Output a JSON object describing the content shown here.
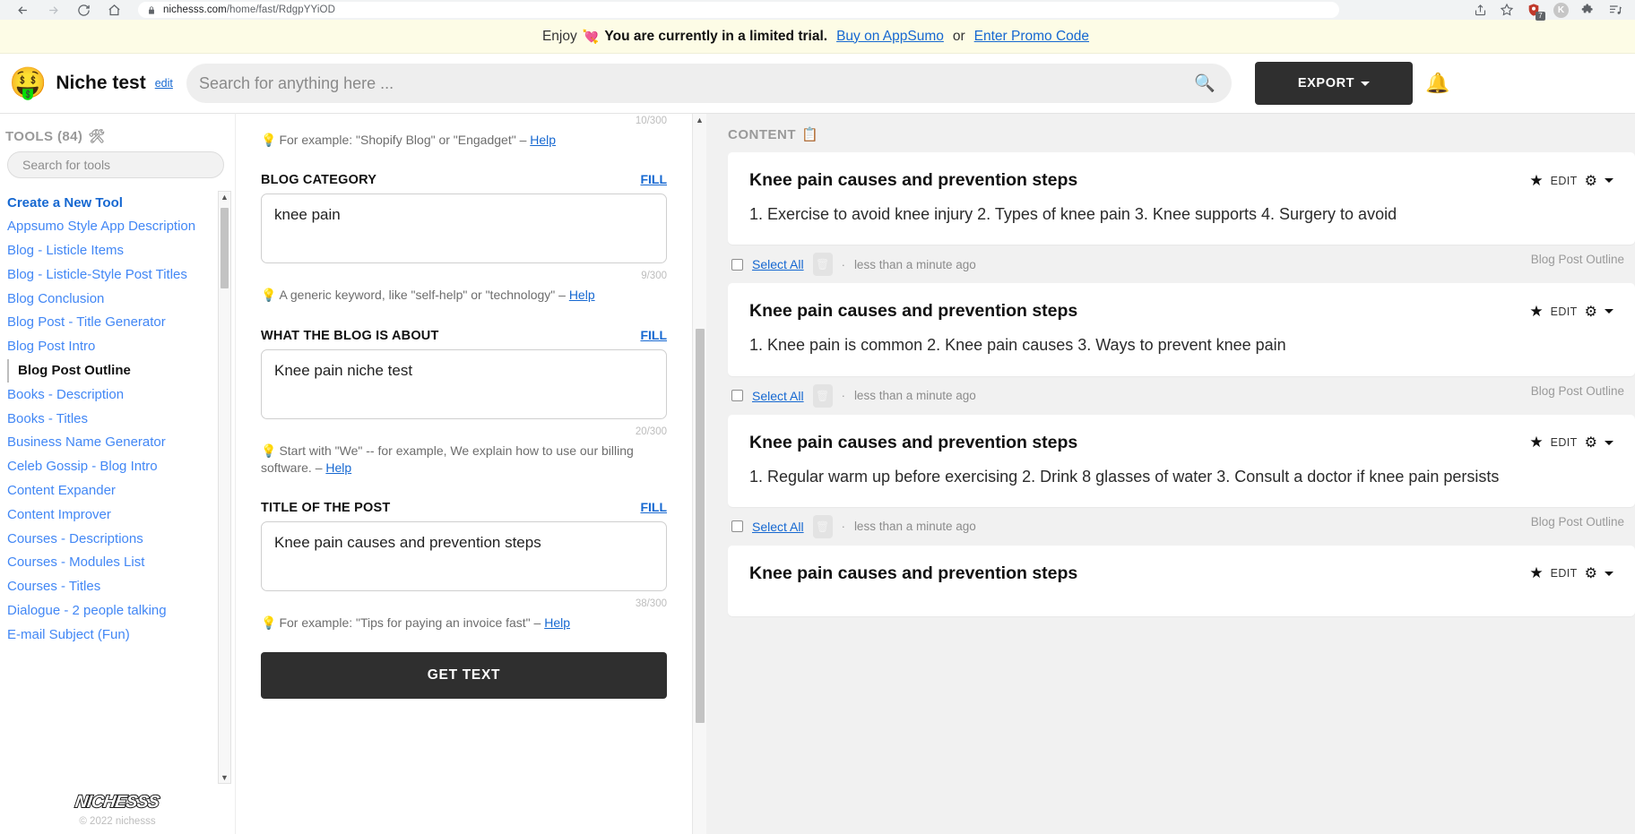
{
  "browser": {
    "url_prefix": "nichesss.com",
    "url_suffix": "/home/fast/RdgpYYiOD",
    "icons": {
      "back": "back-arrow-icon",
      "forward": "forward-arrow-icon",
      "reload": "reload-icon",
      "home": "home-icon",
      "lock": "lock-icon",
      "share": "share-icon",
      "bookmark": "star-bookmark-icon",
      "shield_extension": "shield-extension-icon",
      "profile": "profile-avatar-icon",
      "extensions": "puzzle-extensions-icon",
      "reading_list": "reading-list-icon"
    },
    "extension_badge_count": "7",
    "profile_initial": "K"
  },
  "banner": {
    "enjoy": "Enjoy",
    "heart": "💘",
    "message": "You are currently in a limited trial.",
    "buy_link": "Buy on AppSumo",
    "or": "or",
    "promo_link": "Enter Promo Code"
  },
  "header": {
    "logo_emoji": "🤑",
    "project_title": "Niche test",
    "edit_label": "edit",
    "search_placeholder": "Search for anything here ...",
    "search_value": "",
    "search_icon": "🔍",
    "export_label": "EXPORT"
  },
  "sidebar": {
    "heading": "TOOLS (84)",
    "heading_emoji": "🛠",
    "search_placeholder": "Search for tools",
    "search_value": "",
    "items": [
      {
        "label": "Create a New Tool",
        "style": "first"
      },
      {
        "label": "Appsumo Style App Description",
        "style": "link"
      },
      {
        "label": "Blog - Listicle Items",
        "style": "link"
      },
      {
        "label": "Blog - Listicle-Style Post Titles",
        "style": "link"
      },
      {
        "label": "Blog Conclusion",
        "style": "link"
      },
      {
        "label": "Blog Post - Title Generator",
        "style": "link"
      },
      {
        "label": "Blog Post Intro",
        "style": "link"
      },
      {
        "label": "Blog Post Outline",
        "style": "active"
      },
      {
        "label": "Books - Description",
        "style": "link"
      },
      {
        "label": "Books - Titles",
        "style": "link"
      },
      {
        "label": "Business Name Generator",
        "style": "link"
      },
      {
        "label": "Celeb Gossip - Blog Intro",
        "style": "link"
      },
      {
        "label": "Content Expander",
        "style": "link"
      },
      {
        "label": "Content Improver",
        "style": "link"
      },
      {
        "label": "Courses - Descriptions",
        "style": "link"
      },
      {
        "label": "Courses - Modules List",
        "style": "link"
      },
      {
        "label": "Courses - Titles",
        "style": "link"
      },
      {
        "label": "Dialogue - 2 people talking",
        "style": "link"
      },
      {
        "label": "E-mail Subject (Fun)",
        "style": "link"
      }
    ],
    "footer_logo": "NICHESSS",
    "copyright": "© 2022 nichesss"
  },
  "form": {
    "top_counter": "10/300",
    "top_hint": "For example: \"Shopify Blog\" or \"Engadget\" – ",
    "top_hint_link": "Help",
    "bulb": "💡",
    "fill_label": "FILL",
    "fields": [
      {
        "label": "BLOG CATEGORY",
        "value": "knee pain",
        "counter": "9/300",
        "hint": "A generic keyword, like \"self-help\" or \"technology\" – ",
        "hint_link": "Help"
      },
      {
        "label": "WHAT THE BLOG IS ABOUT",
        "value": "Knee pain niche test",
        "counter": "20/300",
        "hint": "Start with \"We\" -- for example, We explain how to use our billing software. – ",
        "hint_link": "Help"
      },
      {
        "label": "TITLE OF THE POST",
        "value": "Knee pain causes and prevention steps",
        "counter": "38/300",
        "hint": "For example: \"Tips for paying an invoice fast\" – ",
        "hint_link": "Help"
      }
    ],
    "submit_label": "GET TEXT"
  },
  "content": {
    "heading": "CONTENT",
    "heading_emoji": "📋",
    "star_icon": "★",
    "edit_label": "EDIT",
    "gear_icon": "⚙",
    "select_all_label": "Select All",
    "trash_icon": "🗑",
    "dot": "·",
    "cards": [
      {
        "title": "Knee pain causes and prevention steps",
        "body": "1. Exercise to avoid knee injury 2. Types of knee pain 3. Knee supports 4. Surgery to avoid",
        "time": "less than a minute ago",
        "tool": "Blog Post Outline"
      },
      {
        "title": "Knee pain causes and prevention steps",
        "body": "1. Knee pain is common 2. Knee pain causes 3. Ways to prevent knee pain",
        "time": "less than a minute ago",
        "tool": "Blog Post Outline"
      },
      {
        "title": "Knee pain causes and prevention steps",
        "body": "1. Regular warm up before exercising 2. Drink 8 glasses of water 3. Consult a doctor if knee pain persists",
        "time": "less than a minute ago",
        "tool": "Blog Post Outline"
      },
      {
        "title": "Knee pain causes and prevention steps",
        "body": "",
        "time": "",
        "tool": ""
      }
    ]
  }
}
